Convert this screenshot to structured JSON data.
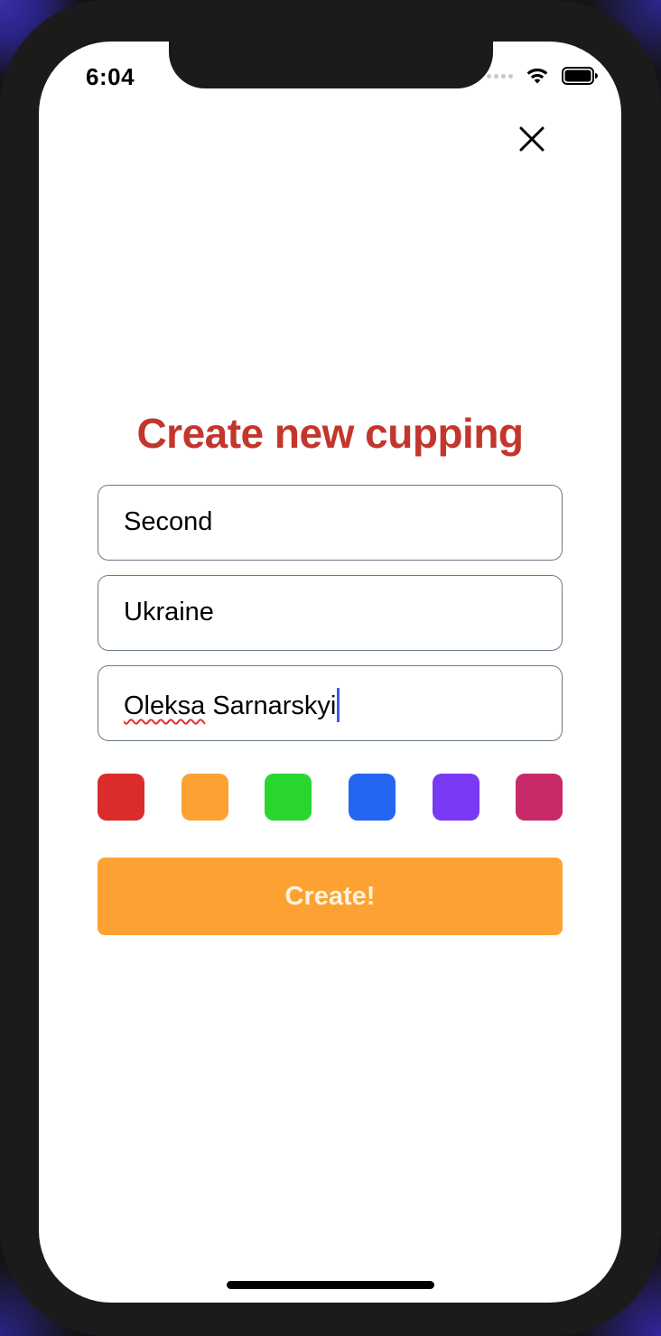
{
  "status_bar": {
    "time": "6:04"
  },
  "form": {
    "title": "Create new cupping",
    "fields": [
      {
        "value": "Second"
      },
      {
        "value": "Ukraine"
      },
      {
        "value_misspelled": "Oleksa",
        "value_rest": " Sarnarskyi"
      }
    ],
    "colors": [
      {
        "name": "red",
        "hex": "#db2b2b"
      },
      {
        "name": "orange",
        "hex": "#fda232"
      },
      {
        "name": "green",
        "hex": "#29d62d"
      },
      {
        "name": "blue",
        "hex": "#2466f2"
      },
      {
        "name": "purple",
        "hex": "#7a39f5"
      },
      {
        "name": "magenta",
        "hex": "#c82a69"
      }
    ],
    "create_label": "Create!",
    "create_color": "#fda232"
  },
  "icons": {
    "close": "close-icon",
    "wifi": "wifi-icon",
    "battery": "battery-icon",
    "signal": "signal-icon"
  }
}
